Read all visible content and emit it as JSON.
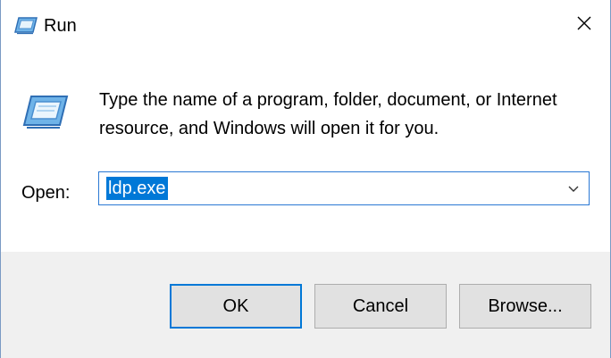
{
  "window": {
    "title": "Run",
    "title_icon": "run-icon",
    "close_icon": "close-icon"
  },
  "body": {
    "icon": "run-icon",
    "message": "Type the name of a program, folder, document, or Internet resource, and Windows will open it for you.",
    "open_label": "Open:"
  },
  "combo": {
    "value": "ldp.exe",
    "dropdown_icon": "chevron-down-icon"
  },
  "buttons": {
    "ok": "OK",
    "cancel": "Cancel",
    "browse": "Browse..."
  },
  "colors": {
    "accent": "#0078d7",
    "footer_bg": "#f0f0f0",
    "button_bg": "#e1e1e1"
  }
}
